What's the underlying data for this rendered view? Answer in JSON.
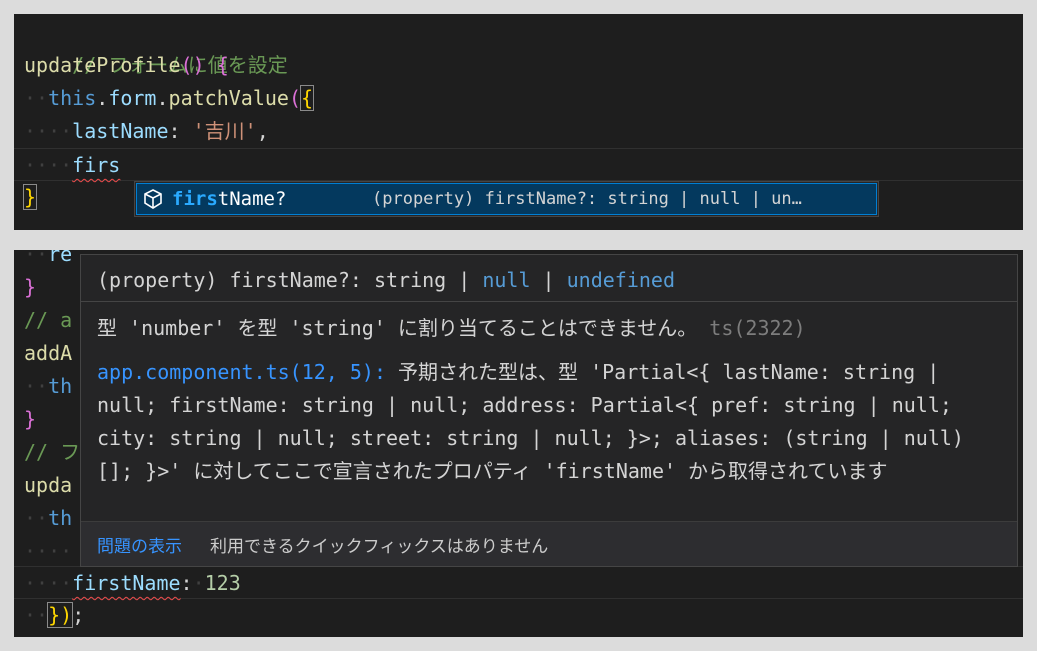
{
  "top_panel": {
    "lines": {
      "comment": "// フォームに値を設定",
      "fn_name": "updateProfile",
      "fn_parens": "()",
      "open_brace": "{",
      "this_kw": "this",
      "dot1": ".",
      "form": "form",
      "dot2": ".",
      "patch": "patchValue",
      "open_paren": "(",
      "open_obj": "{",
      "lastname_key": "lastName",
      "colon": ":",
      "lastname_val": "'吉川'",
      "comma": ",",
      "typed": "firs",
      "close_brace": "}"
    },
    "suggest": {
      "icon": "cube-icon",
      "label_match": "firs",
      "label_rest": "tName?",
      "detail": "(property) firstName?: string | null | un…"
    }
  },
  "bottom_panel": {
    "lines": {
      "l1_frag": "re",
      "l2": "}",
      "l3_comment": "// a",
      "l4": "addA",
      "l5": "th",
      "l6": "}",
      "l7_comment": "// フ",
      "l8": "upda",
      "l9": "th",
      "key": "firstName",
      "colon": ":",
      "val": "123",
      "close": "})",
      "semi": ";"
    },
    "hover": {
      "sig_pre": "(property) firstName?: string ",
      "sig_pipe1": "|",
      "sig_null": "null",
      "sig_pipe2": "|",
      "sig_undef": "undefined",
      "message": "型 'number' を型 'string' に割り当てることはできません。",
      "code": "ts(2322)",
      "related_link": "app.component.ts(12, 5):",
      "related_text": " 予期された型は、型 'Partial<{ lastName: string | null; firstName: string | null; address: Partial<{ pref: string | null; city: string | null; street: string | null; }>; aliases: (string | null)[]; }>' に対してここで宣言されたプロパティ 'firstName' から取得されています",
      "view_problem": "問題の表示",
      "no_quickfix": "利用できるクイックフィックスはありません"
    }
  }
}
